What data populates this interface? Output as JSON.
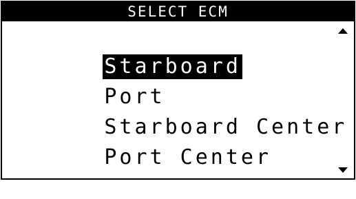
{
  "header": {
    "title": "SELECT ECM"
  },
  "menu": {
    "items": [
      {
        "label": "Starboard",
        "selected": true
      },
      {
        "label": "Port",
        "selected": false
      },
      {
        "label": "Starboard Center",
        "selected": false
      },
      {
        "label": "Port Center",
        "selected": false
      }
    ]
  },
  "icons": {
    "scroll_up": "triangle-up-icon",
    "scroll_down": "triangle-down-icon"
  },
  "colors": {
    "foreground": "#000000",
    "background": "#ffffff"
  }
}
